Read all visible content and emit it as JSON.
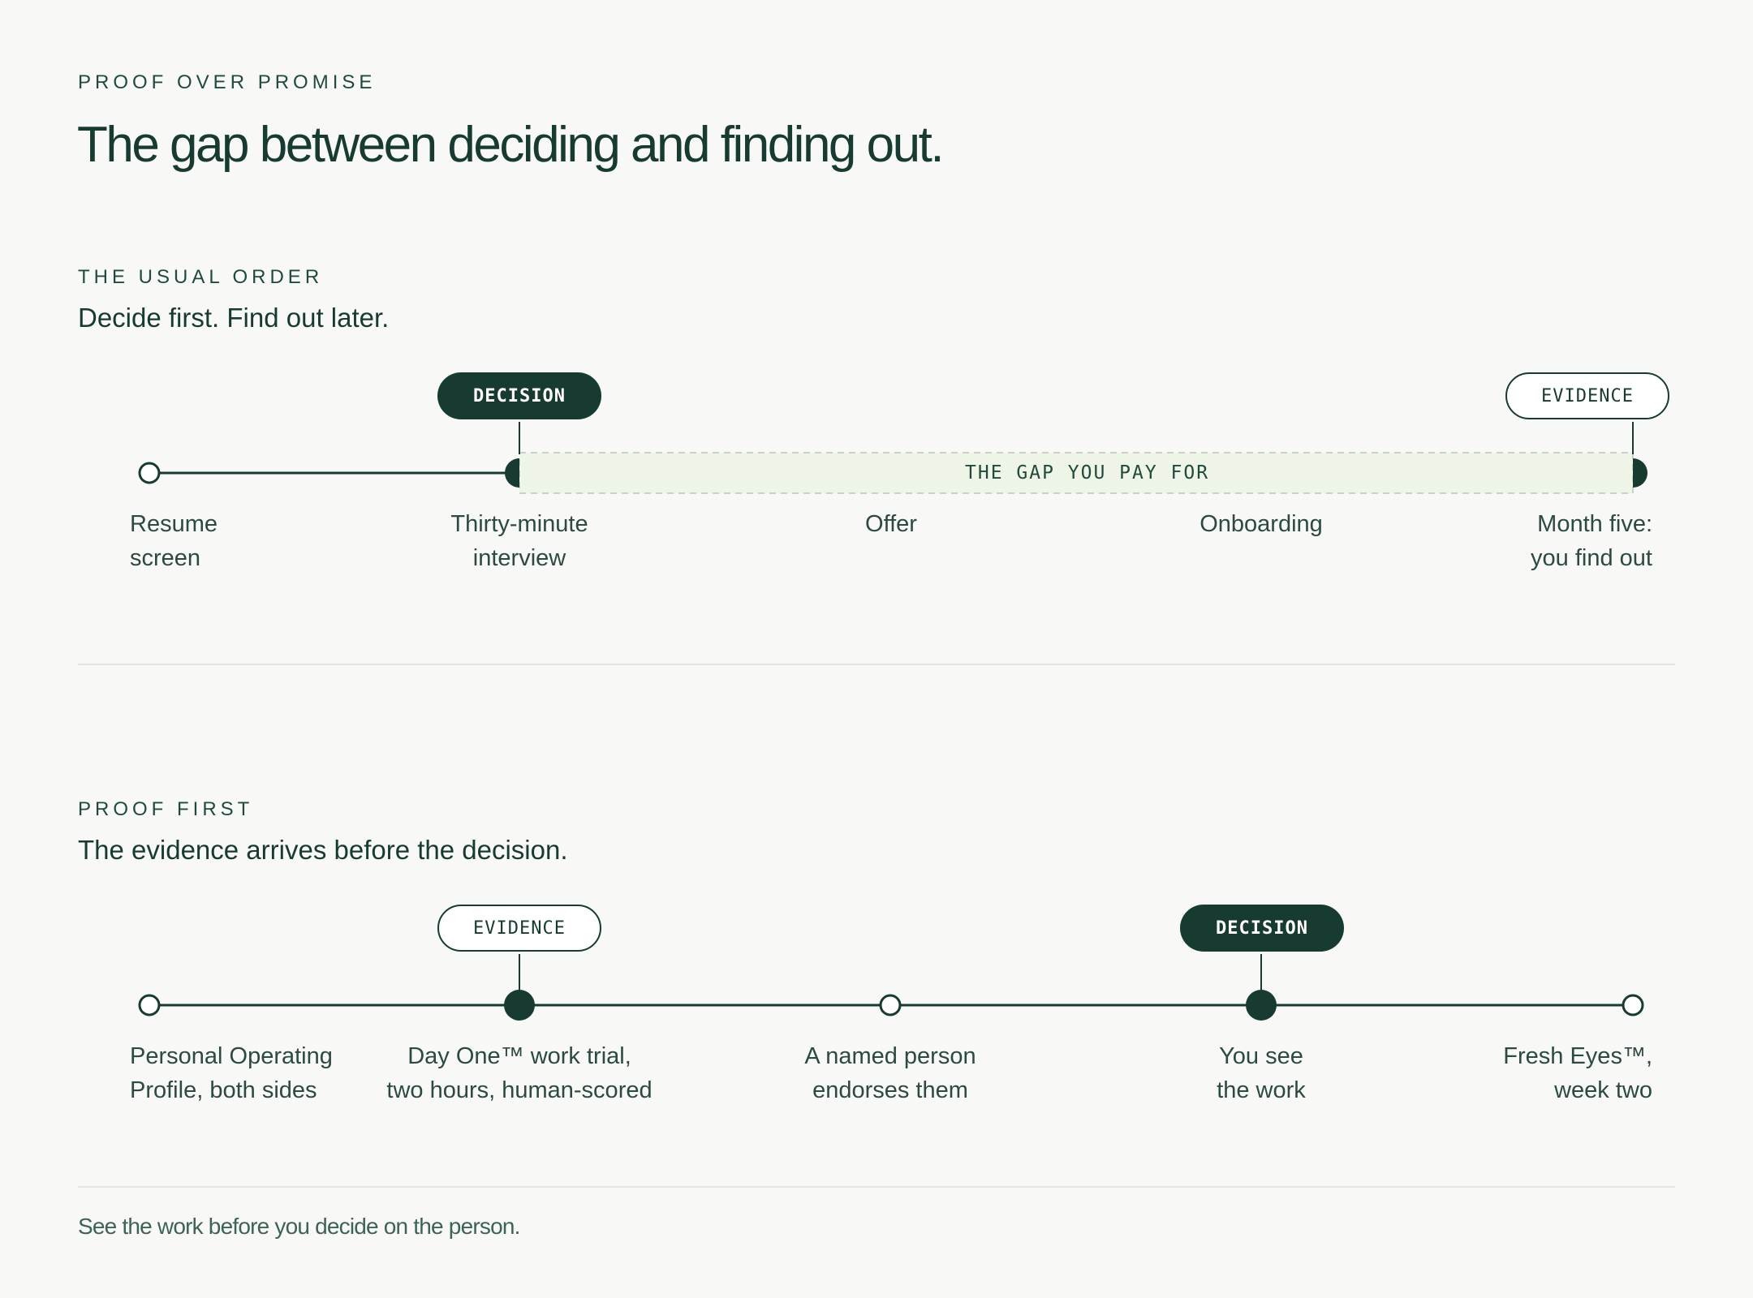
{
  "header": {
    "eyebrow": "PROOF OVER PROMISE",
    "title": "The gap between deciding and finding out."
  },
  "usual_order": {
    "eyebrow": "THE USUAL ORDER",
    "subtitle": "Decide first. Find out later.",
    "decision_pill": "DECISION",
    "evidence_pill": "EVIDENCE",
    "gap_label": "THE GAP YOU PAY FOR",
    "stages": [
      {
        "label": "Resume\nscreen"
      },
      {
        "label": "Thirty-minute\ninterview"
      },
      {
        "label": "Offer"
      },
      {
        "label": "Onboarding"
      },
      {
        "label": "Month five:\nyou find out"
      }
    ]
  },
  "proof_first": {
    "eyebrow": "PROOF FIRST",
    "subtitle": "The evidence arrives before the decision.",
    "evidence_pill": "EVIDENCE",
    "decision_pill": "DECISION",
    "stages": [
      {
        "label": "Personal Operating\nProfile, both sides"
      },
      {
        "label": "Day One™ work trial,\ntwo hours, human-scored"
      },
      {
        "label": "A named person\nendorses them"
      },
      {
        "label": "You see\nthe work"
      },
      {
        "label": "Fresh Eyes™,\nweek two"
      }
    ]
  },
  "footer": {
    "text": "See the work before you decide on the person."
  },
  "colors": {
    "ink": "#173a31",
    "gap_fill": "#eef4e6",
    "background": "#f8f8f7"
  }
}
